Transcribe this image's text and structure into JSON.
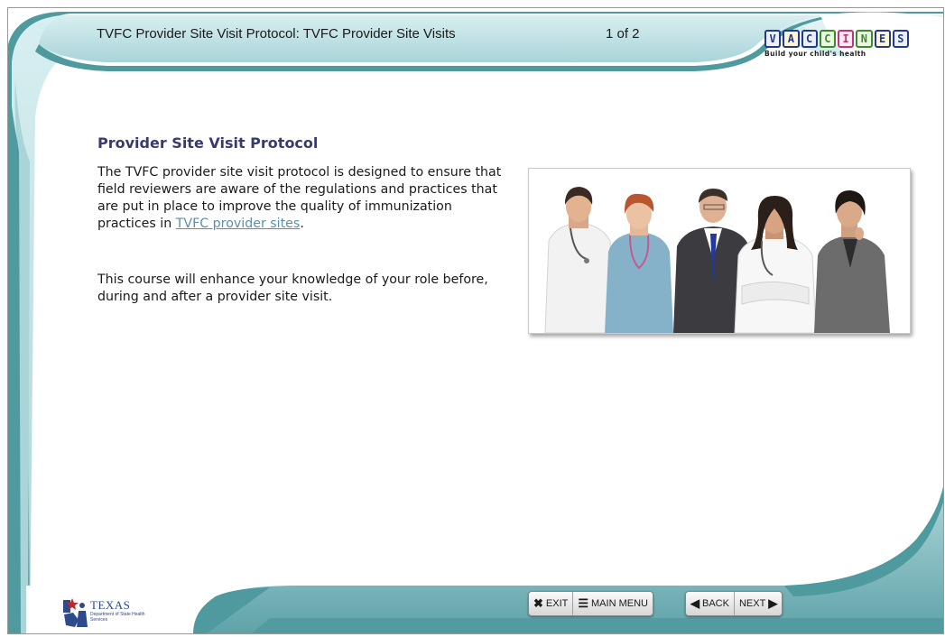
{
  "header": {
    "title": "TVFC Provider Site Visit Protocol: TVFC Provider Site Visits",
    "page_counter": "1 of 2"
  },
  "logo": {
    "letters": [
      "V",
      "A",
      "C",
      "C",
      "I",
      "N",
      "E",
      "S"
    ],
    "tagline": "Build your child's health"
  },
  "content": {
    "heading": "Provider Site Visit Protocol",
    "paragraph1_text": "The TVFC provider site visit protocol is designed to ensure that field reviewers are aware of the regulations and practices that are put in place to improve the quality of immunization practices in ",
    "paragraph1_link": "TVFC provider sites",
    "paragraph1_end": ".",
    "paragraph2": "This course will enhance your knowledge of your role before, during and after a provider site visit."
  },
  "footer": {
    "org_name": "TEXAS",
    "org_sub": "Department of State Health Services"
  },
  "nav": {
    "exit_label": "EXIT",
    "main_menu_label": "MAIN MENU",
    "back_label": "BACK",
    "next_label": "NEXT"
  },
  "colors": {
    "teal_dark": "#4f9a9f",
    "teal_light": "#cfe9ec",
    "link": "#5a8fae",
    "heading": "#3a3a6e"
  }
}
